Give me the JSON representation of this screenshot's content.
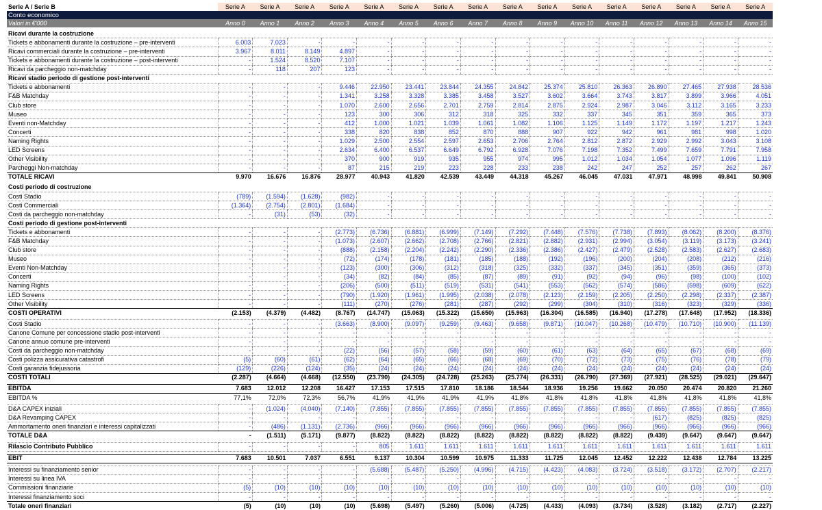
{
  "header": {
    "corner_label": "Serie A / Serie B",
    "series_labels": [
      "Serie A",
      "Serie A",
      "Serie A",
      "Serie A",
      "Serie A",
      "Serie A",
      "Serie A",
      "Serie A",
      "Serie A",
      "Serie A",
      "Serie A",
      "Serie A",
      "Serie A",
      "Serie A",
      "Serie A",
      "Serie A"
    ],
    "section_title": "Conto economico",
    "unit_label": "Valori in €'000",
    "years": [
      "Anno 0",
      "Anno 1",
      "Anno 2",
      "Anno 3",
      "Anno 4",
      "Anno 5",
      "Anno 6",
      "Anno 7",
      "Anno 8",
      "Anno 9",
      "Anno 10",
      "Anno 11",
      "Anno 12",
      "Anno 13",
      "Anno 14",
      "Anno 15"
    ]
  },
  "rows": [
    {
      "kind": "blank"
    },
    {
      "kind": "sec",
      "label": "Ricavi durante la costruzione"
    },
    {
      "kind": "input",
      "label": "Tickets e abbonamenti durante la costruzione – pre-interventi",
      "values": [
        "6.003",
        "7.023",
        "-",
        "-",
        "-",
        "-",
        "-",
        "-",
        "-",
        "-",
        "-",
        "-",
        "-",
        "-",
        "-",
        "-"
      ]
    },
    {
      "kind": "input",
      "label": "Ricavi commerciali durante la costruzione – pre-interventi",
      "values": [
        "3.967",
        "8.011",
        "8.149",
        "4.897",
        "-",
        "-",
        "-",
        "-",
        "-",
        "-",
        "-",
        "-",
        "-",
        "-",
        "-",
        "-"
      ]
    },
    {
      "kind": "input",
      "label": "Tickets e abbonamenti durante la costruzione – post-interventi",
      "values": [
        "-",
        "1.524",
        "8.520",
        "7.107",
        "-",
        "-",
        "-",
        "-",
        "-",
        "-",
        "-",
        "-",
        "-",
        "-",
        "-",
        "-"
      ]
    },
    {
      "kind": "input",
      "label": "Ricavi da parcheggio non-matchday",
      "values": [
        "-",
        "118",
        "207",
        "123",
        "-",
        "-",
        "-",
        "-",
        "-",
        "-",
        "-",
        "-",
        "-",
        "-",
        "-",
        "-"
      ]
    },
    {
      "kind": "sec",
      "label": "Ricavi stadio periodo di gestione post-interventi"
    },
    {
      "kind": "input",
      "label": "Tickets e abbonamenti",
      "values": [
        "-",
        "-",
        "-",
        "9.446",
        "22.950",
        "23.441",
        "23.844",
        "24.355",
        "24.842",
        "25.374",
        "25.810",
        "26.363",
        "26.890",
        "27.465",
        "27.938",
        "28.536"
      ]
    },
    {
      "kind": "input",
      "label": "F&B Matchday",
      "values": [
        "-",
        "-",
        "-",
        "1.341",
        "3.258",
        "3.328",
        "3.385",
        "3.458",
        "3.527",
        "3.602",
        "3.664",
        "3.743",
        "3.817",
        "3.899",
        "3.966",
        "4.051"
      ]
    },
    {
      "kind": "input",
      "label": "Club store",
      "values": [
        "-",
        "-",
        "-",
        "1.070",
        "2.600",
        "2.656",
        "2.701",
        "2.759",
        "2.814",
        "2.875",
        "2.924",
        "2.987",
        "3.046",
        "3.112",
        "3.165",
        "3.233"
      ]
    },
    {
      "kind": "input",
      "label": "Museo",
      "values": [
        "-",
        "-",
        "-",
        "123",
        "300",
        "306",
        "312",
        "318",
        "325",
        "332",
        "337",
        "345",
        "351",
        "359",
        "365",
        "373"
      ]
    },
    {
      "kind": "input",
      "label": "Eventi non-Matchday",
      "values": [
        "-",
        "-",
        "-",
        "412",
        "1.000",
        "1.021",
        "1.039",
        "1.061",
        "1.082",
        "1.106",
        "1.125",
        "1.149",
        "1.172",
        "1.197",
        "1.217",
        "1.243"
      ]
    },
    {
      "kind": "input",
      "label": "Concerti",
      "values": [
        "-",
        "-",
        "-",
        "338",
        "820",
        "838",
        "852",
        "870",
        "888",
        "907",
        "922",
        "942",
        "961",
        "981",
        "998",
        "1.020"
      ]
    },
    {
      "kind": "input",
      "label": "Naming Rights",
      "values": [
        "-",
        "-",
        "-",
        "1.029",
        "2.500",
        "2.554",
        "2.597",
        "2.653",
        "2.706",
        "2.764",
        "2.812",
        "2.872",
        "2.929",
        "2.992",
        "3.043",
        "3.108"
      ]
    },
    {
      "kind": "input",
      "label": "LED Screens",
      "values": [
        "-",
        "-",
        "-",
        "2.634",
        "6.400",
        "6.537",
        "6.649",
        "6.792",
        "6.928",
        "7.076",
        "7.198",
        "7.352",
        "7.499",
        "7.659",
        "7.791",
        "7.958"
      ]
    },
    {
      "kind": "input",
      "label": "Other Visibility",
      "values": [
        "-",
        "-",
        "-",
        "370",
        "900",
        "919",
        "935",
        "955",
        "974",
        "995",
        "1.012",
        "1.034",
        "1.054",
        "1.077",
        "1.096",
        "1.119"
      ]
    },
    {
      "kind": "input",
      "label": "Parcheggi Non-matchday",
      "values": [
        "-",
        "-",
        "-",
        "87",
        "215",
        "219",
        "223",
        "228",
        "233",
        "238",
        "242",
        "247",
        "252",
        "257",
        "262",
        "267"
      ]
    },
    {
      "kind": "total",
      "label": "TOTALE RICAVI",
      "values": [
        "9.970",
        "16.676",
        "16.876",
        "28.977",
        "40.943",
        "41.820",
        "42.539",
        "43.449",
        "44.318",
        "45.267",
        "46.045",
        "47.031",
        "47.971",
        "48.998",
        "49.841",
        "50.908"
      ]
    },
    {
      "kind": "blank"
    },
    {
      "kind": "sec",
      "label": "Costi periodo di costruzione"
    },
    {
      "kind": "input",
      "label": "Costi Stadio",
      "values": [
        "(789)",
        "(1.594)",
        "(1.628)",
        "(982)",
        "-",
        "-",
        "-",
        "-",
        "-",
        "-",
        "-",
        "-",
        "-",
        "-",
        "-",
        "-"
      ]
    },
    {
      "kind": "input",
      "label": "Costi Commerciali",
      "values": [
        "(1.364)",
        "(2.754)",
        "(2.801)",
        "(1.684)",
        "-",
        "-",
        "-",
        "-",
        "-",
        "-",
        "-",
        "-",
        "-",
        "-",
        "-",
        "-"
      ]
    },
    {
      "kind": "input",
      "label": "Costi da parcheggio non-matchday",
      "values": [
        "-",
        "(31)",
        "(53)",
        "(32)",
        "-",
        "-",
        "-",
        "-",
        "-",
        "-",
        "-",
        "-",
        "-",
        "-",
        "-",
        "-"
      ]
    },
    {
      "kind": "sec",
      "label": "Costi periodo di gestione post-interventi"
    },
    {
      "kind": "input",
      "label": "Tickets e abbonamenti",
      "values": [
        "-",
        "-",
        "-",
        "(2.773)",
        "(6.736)",
        "(6.881)",
        "(6.999)",
        "(7.149)",
        "(7.292)",
        "(7.448)",
        "(7.576)",
        "(7.738)",
        "(7.893)",
        "(8.062)",
        "(8.200)",
        "(8.376)"
      ]
    },
    {
      "kind": "input",
      "label": "F&B Matchday",
      "values": [
        "-",
        "-",
        "-",
        "(1.073)",
        "(2.607)",
        "(2.662)",
        "(2.708)",
        "(2.766)",
        "(2.821)",
        "(2.882)",
        "(2.931)",
        "(2.994)",
        "(3.054)",
        "(3.119)",
        "(3.173)",
        "(3.241)"
      ]
    },
    {
      "kind": "input",
      "label": "Club store",
      "values": [
        "-",
        "-",
        "-",
        "(888)",
        "(2.158)",
        "(2.204)",
        "(2.242)",
        "(2.290)",
        "(2.336)",
        "(2.386)",
        "(2.427)",
        "(2.479)",
        "(2.528)",
        "(2.583)",
        "(2.627)",
        "(2.683)"
      ]
    },
    {
      "kind": "input",
      "label": "Museo",
      "values": [
        "-",
        "-",
        "-",
        "(72)",
        "(174)",
        "(178)",
        "(181)",
        "(185)",
        "(188)",
        "(192)",
        "(196)",
        "(200)",
        "(204)",
        "(208)",
        "(212)",
        "(216)"
      ]
    },
    {
      "kind": "input",
      "label": "Eventi Non-Matchday",
      "values": [
        "-",
        "-",
        "-",
        "(123)",
        "(300)",
        "(306)",
        "(312)",
        "(318)",
        "(325)",
        "(332)",
        "(337)",
        "(345)",
        "(351)",
        "(359)",
        "(365)",
        "(373)"
      ]
    },
    {
      "kind": "input",
      "label": "Concerti",
      "values": [
        "-",
        "-",
        "-",
        "(34)",
        "(82)",
        "(84)",
        "(85)",
        "(87)",
        "(89)",
        "(91)",
        "(92)",
        "(94)",
        "(96)",
        "(98)",
        "(100)",
        "(102)"
      ]
    },
    {
      "kind": "input",
      "label": "Naming Rights",
      "values": [
        "-",
        "-",
        "-",
        "(206)",
        "(500)",
        "(511)",
        "(519)",
        "(531)",
        "(541)",
        "(553)",
        "(562)",
        "(574)",
        "(586)",
        "(598)",
        "(609)",
        "(622)"
      ]
    },
    {
      "kind": "input",
      "label": "LED Screens",
      "values": [
        "-",
        "-",
        "-",
        "(790)",
        "(1.920)",
        "(1.961)",
        "(1.995)",
        "(2.038)",
        "(2.078)",
        "(2.123)",
        "(2.159)",
        "(2.205)",
        "(2.250)",
        "(2.298)",
        "(2.337)",
        "(2.387)"
      ]
    },
    {
      "kind": "input",
      "label": "Other Visibility",
      "values": [
        "-",
        "-",
        "-",
        "(111)",
        "(270)",
        "(276)",
        "(281)",
        "(287)",
        "(292)",
        "(299)",
        "(304)",
        "(310)",
        "(316)",
        "(323)",
        "(329)",
        "(336)"
      ]
    },
    {
      "kind": "total",
      "label": "COSTI OPERATIVI",
      "values": [
        "(2.153)",
        "(4.379)",
        "(4.482)",
        "(8.767)",
        "(14.747)",
        "(15.063)",
        "(15.322)",
        "(15.650)",
        "(15.963)",
        "(16.304)",
        "(16.585)",
        "(16.940)",
        "(17.278)",
        "(17.648)",
        "(17.952)",
        "(18.336)"
      ]
    },
    {
      "kind": "blank"
    },
    {
      "kind": "input",
      "label": "Costi Stadio",
      "values": [
        "-",
        "-",
        "-",
        "(3.663)",
        "(8.900)",
        "(9.097)",
        "(9.259)",
        "(9.463)",
        "(9.658)",
        "(9.871)",
        "(10.047)",
        "(10.268)",
        "(10.479)",
        "(10.710)",
        "(10.900)",
        "(11.139)"
      ]
    },
    {
      "kind": "input",
      "label": "Canone Comune per concessione stadio post-interventi",
      "values": [
        "-",
        "-",
        "-",
        "-",
        "-",
        "-",
        "-",
        "-",
        "-",
        "-",
        "-",
        "-",
        "-",
        "-",
        "-",
        "-"
      ]
    },
    {
      "kind": "input",
      "label": "Canone annuo comune pre-interventi",
      "values": [
        "-",
        "-",
        "-",
        "-",
        "-",
        "-",
        "-",
        "-",
        "-",
        "-",
        "-",
        "-",
        "-",
        "-",
        "-",
        "-"
      ]
    },
    {
      "kind": "input",
      "label": "Costi da parcheggio non-matchday",
      "values": [
        "-",
        "-",
        "-",
        "(22)",
        "(56)",
        "(57)",
        "(58)",
        "(59)",
        "(60)",
        "(61)",
        "(63)",
        "(64)",
        "(65)",
        "(67)",
        "(68)",
        "(69)"
      ]
    },
    {
      "kind": "input",
      "label": "Costi polizza assicurativa catastrofi",
      "values": [
        "(5)",
        "(60)",
        "(61)",
        "(62)",
        "(64)",
        "(65)",
        "(66)",
        "(68)",
        "(69)",
        "(70)",
        "(72)",
        "(73)",
        "(75)",
        "(76)",
        "(78)",
        "(79)"
      ]
    },
    {
      "kind": "input",
      "label": "Costi garanzia fidejussoria",
      "values": [
        "(129)",
        "(226)",
        "(124)",
        "(35)",
        "(24)",
        "(24)",
        "(24)",
        "(24)",
        "(24)",
        "(24)",
        "(24)",
        "(24)",
        "(24)",
        "(24)",
        "(24)",
        "(24)"
      ]
    },
    {
      "kind": "total",
      "label": "COSTI TOTALI",
      "values": [
        "(2.287)",
        "(4.664)",
        "(4.668)",
        "(12.550)",
        "(23.790)",
        "(24.305)",
        "(24.728)",
        "(25.263)",
        "(25.774)",
        "(26.331)",
        "(26.790)",
        "(27.369)",
        "(27.921)",
        "(28.525)",
        "(29.021)",
        "(29.647)"
      ]
    },
    {
      "kind": "blank"
    },
    {
      "kind": "boldline",
      "label": "EBITDA",
      "values": [
        "7.683",
        "12.012",
        "12.208",
        "16.427",
        "17.153",
        "17.515",
        "17.810",
        "18.186",
        "18.544",
        "18.936",
        "19.256",
        "19.662",
        "20.050",
        "20.474",
        "20.820",
        "21.260"
      ]
    },
    {
      "kind": "plain",
      "label": "EBITDA %",
      "values": [
        "77,1%",
        "72,0%",
        "72,3%",
        "56,7%",
        "41,9%",
        "41,9%",
        "41,9%",
        "41,9%",
        "41,8%",
        "41,8%",
        "41,8%",
        "41,8%",
        "41,8%",
        "41,8%",
        "41,8%",
        "41,8%"
      ]
    },
    {
      "kind": "blank"
    },
    {
      "kind": "input",
      "label": "D&A CAPEX iniziali",
      "values": [
        "-",
        "(1.024)",
        "(4.040)",
        "(7.140)",
        "(7.855)",
        "(7.855)",
        "(7.855)",
        "(7.855)",
        "(7.855)",
        "(7.855)",
        "(7.855)",
        "(7.855)",
        "(7.855)",
        "(7.855)",
        "(7.855)",
        "(7.855)"
      ]
    },
    {
      "kind": "input",
      "label": "D&A Revamping CAPEX",
      "values": [
        "-",
        "-",
        "-",
        "-",
        "-",
        "-",
        "-",
        "-",
        "-",
        "-",
        "-",
        "-",
        "(617)",
        "(825)",
        "(825)",
        "(825)"
      ]
    },
    {
      "kind": "input",
      "label": "Ammortamento oneri finanziari e interessi capitalizzati",
      "values": [
        "-",
        "(486)",
        "(1.131)",
        "(2.736)",
        "(966)",
        "(966)",
        "(966)",
        "(966)",
        "(966)",
        "(966)",
        "(966)",
        "(966)",
        "(966)",
        "(966)",
        "(966)",
        "(966)"
      ]
    },
    {
      "kind": "total",
      "label": "TOTALE D&A",
      "values": [
        "-",
        "(1.511)",
        "(5.171)",
        "(9.877)",
        "(8.822)",
        "(8.822)",
        "(8.822)",
        "(8.822)",
        "(8.822)",
        "(8.822)",
        "(8.822)",
        "(8.822)",
        "(9.439)",
        "(9.647)",
        "(9.647)",
        "(9.647)"
      ]
    },
    {
      "kind": "blank"
    },
    {
      "kind": "input",
      "label": "Rilascio Contributo Pubblico",
      "bold": true,
      "values": [
        "-",
        "-",
        "-",
        "-",
        "805",
        "1.611",
        "1.611",
        "1.611",
        "1.611",
        "1.611",
        "1.611",
        "1.611",
        "1.611",
        "1.611",
        "1.611",
        "1.611"
      ]
    },
    {
      "kind": "blank"
    },
    {
      "kind": "boldline",
      "label": "EBIT",
      "values": [
        "7.683",
        "10.501",
        "7.037",
        "6.551",
        "9.137",
        "10.304",
        "10.599",
        "10.975",
        "11.333",
        "11.725",
        "12.045",
        "12.452",
        "12.222",
        "12.438",
        "12.784",
        "13.225"
      ]
    },
    {
      "kind": "blank"
    },
    {
      "kind": "input",
      "label": "Interessi su finanziamento senior",
      "values": [
        "-",
        "-",
        "-",
        "-",
        "(5.688)",
        "(5.487)",
        "(5.250)",
        "(4.996)",
        "(4.715)",
        "(4.423)",
        "(4.083)",
        "(3.724)",
        "(3.518)",
        "(3.172)",
        "(2.707)",
        "(2.217)"
      ]
    },
    {
      "kind": "input",
      "label": "Interessi su linea IVA",
      "values": [
        "-",
        "-",
        "-",
        "-",
        "-",
        "-",
        "-",
        "-",
        "-",
        "-",
        "-",
        "-",
        "-",
        "-",
        "-",
        "-"
      ]
    },
    {
      "kind": "input",
      "label": "Commissioni finanziarie",
      "values": [
        "(5)",
        "(10)",
        "(10)",
        "(10)",
        "(10)",
        "(10)",
        "(10)",
        "(10)",
        "(10)",
        "(10)",
        "(10)",
        "(10)",
        "(10)",
        "(10)",
        "(10)",
        "(10)"
      ]
    },
    {
      "kind": "input",
      "label": "Interessi finanziamento soci",
      "values": [
        "-",
        "-",
        "-",
        "-",
        "-",
        "-",
        "-",
        "-",
        "-",
        "-",
        "-",
        "-",
        "-",
        "-",
        "-",
        "-"
      ]
    },
    {
      "kind": "total",
      "label": "Totale oneri finanziari",
      "values": [
        "(5)",
        "(10)",
        "(10)",
        "(10)",
        "(5.698)",
        "(5.497)",
        "(5.260)",
        "(5.006)",
        "(4.725)",
        "(4.433)",
        "(4.093)",
        "(3.734)",
        "(3.528)",
        "(3.182)",
        "(2.717)",
        "(2.227)"
      ]
    }
  ]
}
